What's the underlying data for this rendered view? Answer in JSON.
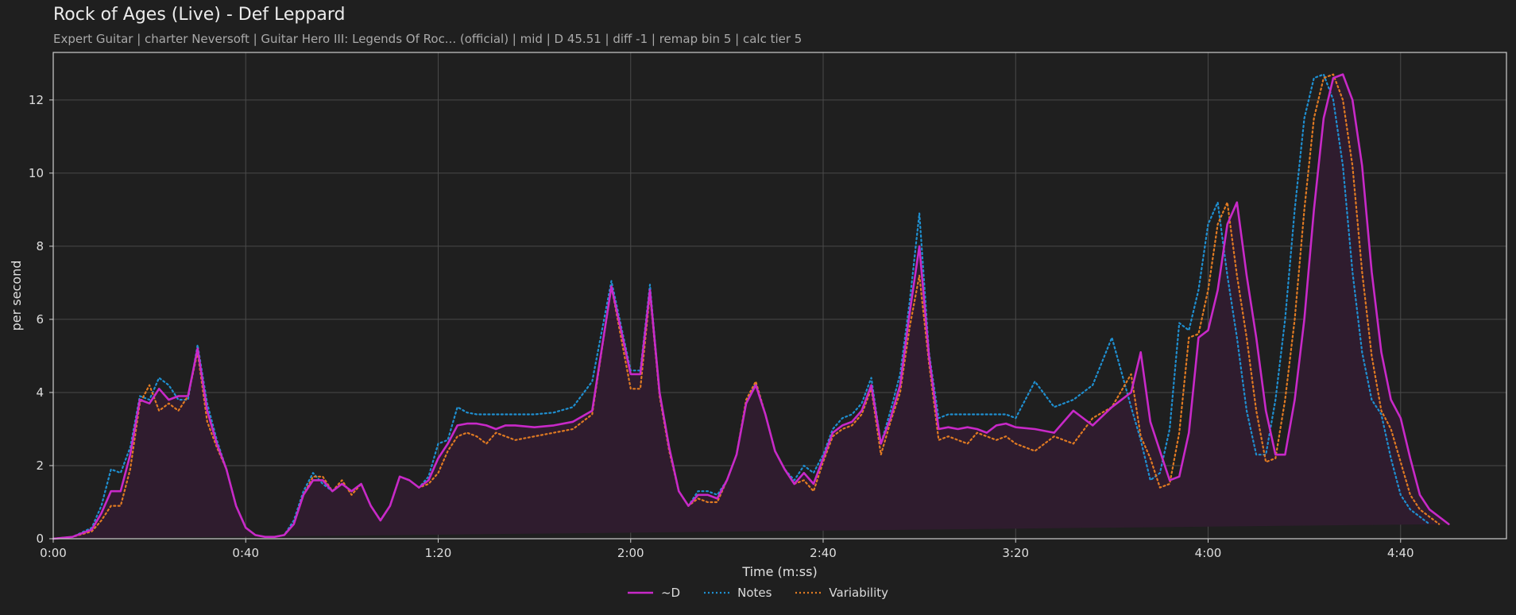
{
  "header": {
    "title": "Rock of Ages (Live) - Def Leppard",
    "subtitle": "Expert Guitar  |  charter Neversoft  |  Guitar Hero III: Legends Of Roc... (official)  |  mid  |  D 45.51  |  diff -1  |  remap bin 5  |  calc tier 5"
  },
  "colors": {
    "background": "#1f1f1f",
    "plot_background": "#1f1f1f",
    "grid": "#4a4a4a",
    "axis": "#cfcfcf",
    "d_line": "#c829c8",
    "d_fill": "#2f1c2e",
    "notes": "#1f8fd0",
    "variability": "#e07a22"
  },
  "chart_data": {
    "type": "line",
    "xlabel": "Time (m:ss)",
    "ylabel": "per second",
    "xlim": [
      0,
      302
    ],
    "ylim": [
      0,
      13.3
    ],
    "x_ticks": [
      0,
      40,
      80,
      120,
      160,
      200,
      240,
      280
    ],
    "x_tick_labels": [
      "0:00",
      "0:40",
      "1:20",
      "2:00",
      "2:40",
      "3:20",
      "4:00",
      "4:40"
    ],
    "y_ticks": [
      0,
      2,
      4,
      6,
      8,
      10,
      12
    ],
    "y_tick_labels": [
      "0",
      "2",
      "4",
      "6",
      "8",
      "10",
      "12"
    ],
    "grid": true,
    "legend_position": "bottom-center",
    "x": [
      0,
      4,
      8,
      10,
      12,
      14,
      16,
      18,
      20,
      22,
      24,
      26,
      28,
      30,
      32,
      34,
      36,
      38,
      40,
      42,
      44,
      46,
      48,
      50,
      52,
      54,
      56,
      58,
      60,
      62,
      64,
      66,
      68,
      70,
      72,
      74,
      76,
      78,
      80,
      82,
      84,
      86,
      88,
      90,
      92,
      94,
      96,
      100,
      104,
      108,
      112,
      116,
      120,
      122,
      124,
      126,
      128,
      130,
      132,
      134,
      136,
      138,
      140,
      142,
      144,
      146,
      148,
      150,
      152,
      154,
      156,
      158,
      160,
      162,
      164,
      166,
      168,
      170,
      172,
      174,
      176,
      178,
      180,
      182,
      184,
      186,
      188,
      190,
      192,
      194,
      196,
      198,
      200,
      204,
      208,
      212,
      216,
      220,
      224,
      226,
      228,
      230,
      232,
      234,
      236,
      238,
      240,
      242,
      244,
      246,
      248,
      250,
      252,
      254,
      256,
      258,
      260,
      262,
      264,
      266,
      268,
      270,
      272,
      274,
      276,
      278,
      280,
      282,
      284,
      286,
      288,
      290,
      292,
      294,
      296,
      298,
      300,
      302
    ],
    "series": [
      {
        "name": "~D",
        "values": [
          0,
          0.05,
          0.25,
          0.7,
          1.3,
          1.3,
          2.3,
          3.8,
          3.7,
          4.1,
          3.8,
          3.9,
          3.9,
          5.2,
          3.5,
          2.6,
          1.9,
          0.9,
          0.3,
          0.1,
          0.05,
          0.05,
          0.1,
          0.4,
          1.2,
          1.6,
          1.6,
          1.3,
          1.5,
          1.3,
          1.5,
          0.9,
          0.5,
          0.9,
          1.7,
          1.6,
          1.4,
          1.6,
          2.2,
          2.6,
          3.1,
          3.15,
          3.15,
          3.1,
          3.0,
          3.1,
          3.1,
          3.05,
          3.1,
          3.2,
          3.5,
          6.9,
          4.5,
          4.5,
          6.8,
          4.0,
          2.5,
          1.3,
          0.9,
          1.2,
          1.2,
          1.1,
          1.6,
          2.3,
          3.7,
          4.2,
          3.4,
          2.4,
          1.9,
          1.5,
          1.8,
          1.5,
          2.2,
          2.9,
          3.1,
          3.2,
          3.5,
          4.2,
          2.6,
          3.3,
          4.2,
          6.2,
          8.0,
          5.0,
          3.0,
          3.05,
          3.0,
          3.05,
          3.0,
          2.9,
          3.1,
          3.15,
          3.05,
          3.0,
          2.9,
          3.5,
          3.1,
          3.6,
          4.0,
          5.1,
          3.2,
          2.4,
          1.6,
          1.7,
          2.9,
          5.5,
          5.7,
          6.8,
          8.6,
          9.2,
          7.2,
          5.5,
          3.5,
          2.3,
          2.3,
          3.8,
          6.0,
          9.0,
          11.5,
          12.6,
          12.7,
          12.0,
          10.2,
          7.3,
          5.1,
          3.8,
          3.3,
          2.2,
          1.2,
          0.8,
          0.6,
          0.4
        ]
      },
      {
        "name": "Notes",
        "values": [
          0,
          0.05,
          0.3,
          0.9,
          1.9,
          1.8,
          2.5,
          3.9,
          3.8,
          4.4,
          4.2,
          3.8,
          3.8,
          5.3,
          3.7,
          2.7,
          1.9,
          0.9,
          0.3,
          0.1,
          0.05,
          0.05,
          0.1,
          0.5,
          1.3,
          1.8,
          1.5,
          1.3,
          1.5,
          1.3,
          1.5,
          0.9,
          0.5,
          0.9,
          1.7,
          1.6,
          1.4,
          1.7,
          2.6,
          2.7,
          3.6,
          3.45,
          3.4,
          3.4,
          3.4,
          3.4,
          3.4,
          3.4,
          3.45,
          3.6,
          4.3,
          7.05,
          4.6,
          4.6,
          6.95,
          4.0,
          2.5,
          1.3,
          0.9,
          1.3,
          1.3,
          1.2,
          1.6,
          2.3,
          3.7,
          4.25,
          3.4,
          2.4,
          1.9,
          1.6,
          2.0,
          1.8,
          2.3,
          3.0,
          3.3,
          3.4,
          3.7,
          4.4,
          2.6,
          3.5,
          4.5,
          6.5,
          8.9,
          5.1,
          3.3,
          3.4,
          3.4,
          3.4,
          3.4,
          3.4,
          3.4,
          3.4,
          3.3,
          4.3,
          3.6,
          3.8,
          4.2,
          5.5,
          3.6,
          2.7,
          1.6,
          1.8,
          3.0,
          5.9,
          5.7,
          6.8,
          8.6,
          9.2,
          7.2,
          5.5,
          3.5,
          2.3,
          2.3,
          3.8,
          6.0,
          9.0,
          11.5,
          12.6,
          12.7,
          12.0,
          10.2,
          7.3,
          5.1,
          3.8,
          3.4,
          2.2,
          1.2,
          0.8,
          0.6,
          0.4
        ]
      },
      {
        "name": "Variability",
        "values": [
          0,
          0.05,
          0.2,
          0.5,
          0.9,
          0.9,
          1.9,
          3.7,
          4.2,
          3.5,
          3.7,
          3.5,
          3.9,
          5.1,
          3.2,
          2.5,
          1.9,
          0.9,
          0.3,
          0.1,
          0.05,
          0.05,
          0.1,
          0.4,
          1.2,
          1.7,
          1.7,
          1.3,
          1.6,
          1.2,
          1.5,
          0.9,
          0.5,
          0.9,
          1.7,
          1.6,
          1.4,
          1.5,
          1.8,
          2.4,
          2.8,
          2.9,
          2.8,
          2.6,
          2.9,
          2.8,
          2.7,
          2.8,
          2.9,
          3.0,
          3.4,
          6.9,
          4.1,
          4.1,
          6.7,
          3.9,
          2.4,
          1.3,
          0.9,
          1.1,
          1.0,
          1.0,
          1.6,
          2.3,
          3.8,
          4.3,
          3.4,
          2.4,
          1.9,
          1.5,
          1.6,
          1.3,
          2.1,
          2.8,
          3.0,
          3.1,
          3.4,
          4.1,
          2.3,
          3.2,
          4.0,
          5.8,
          7.2,
          4.8,
          2.7,
          2.8,
          2.7,
          2.6,
          2.9,
          2.8,
          2.7,
          2.8,
          2.6,
          2.4,
          2.8,
          2.6,
          3.3,
          3.6,
          4.5,
          2.8,
          2.2,
          1.4,
          1.5,
          2.9,
          5.5,
          5.6,
          6.8,
          8.6,
          9.2,
          7.2,
          5.5,
          3.5,
          2.1,
          2.2,
          3.8,
          6.0,
          9.0,
          11.5,
          12.6,
          12.7,
          12.0,
          10.2,
          7.3,
          5.0,
          3.5,
          3.0,
          2.1,
          1.2,
          0.8,
          0.6,
          0.4
        ]
      }
    ]
  }
}
